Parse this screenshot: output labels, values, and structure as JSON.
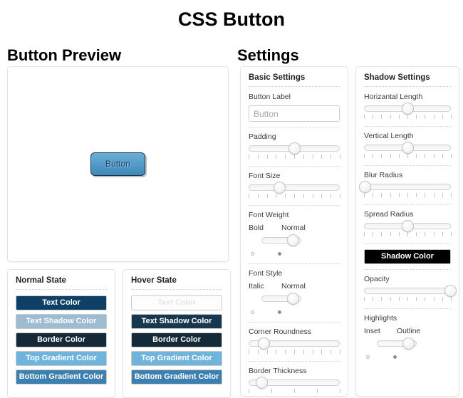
{
  "page": {
    "title": "CSS Button"
  },
  "preview": {
    "heading": "Button Preview",
    "button_label": "Button"
  },
  "settings": {
    "heading": "Settings"
  },
  "normal_state": {
    "title": "Normal State",
    "swatches": [
      {
        "label": "Text Color",
        "bg": "#0e3f66",
        "fg": "#ffffff"
      },
      {
        "label": "Text Shadow Color",
        "bg": "#9dbcd2",
        "fg": "#ffffff"
      },
      {
        "label": "Border Color",
        "bg": "#152a38",
        "fg": "#ffffff"
      },
      {
        "label": "Top Gradient Color",
        "bg": "#6fb4dd",
        "fg": "#ffffff"
      },
      {
        "label": "Bottom Gradient Color",
        "bg": "#3d80b0",
        "fg": "#ffffff"
      }
    ]
  },
  "hover_state": {
    "title": "Hover State",
    "swatches": [
      {
        "label": "Text Color",
        "bg": "#fdfdfd",
        "fg": "#dfe7ec"
      },
      {
        "label": "Text Shadow Color",
        "bg": "#16374e",
        "fg": "#ffffff"
      },
      {
        "label": "Border Color",
        "bg": "#152a38",
        "fg": "#ffffff"
      },
      {
        "label": "Top Gradient Color",
        "bg": "#6fb4dd",
        "fg": "#ffffff"
      },
      {
        "label": "Bottom Gradient Color",
        "bg": "#3d80b0",
        "fg": "#ffffff"
      }
    ]
  },
  "basic_settings": {
    "title": "Basic Settings",
    "button_label_field": {
      "label": "Button Label",
      "value": "",
      "placeholder": "Button"
    },
    "sliders": [
      {
        "label": "Padding",
        "percent": 50,
        "ticks": 11
      },
      {
        "label": "Font Size",
        "percent": 34,
        "ticks": 11
      },
      {
        "label": "Corner Roundness",
        "percent": 16,
        "ticks": 11
      },
      {
        "label": "Border Thickness",
        "percent": 14,
        "ticks": 5
      }
    ],
    "toggles": [
      {
        "label": "Font Weight",
        "option_left": "Bold",
        "option_right": "Normal",
        "selected": "Normal"
      },
      {
        "label": "Font Style",
        "option_left": "Italic",
        "option_right": "Normal",
        "selected": "Normal"
      }
    ]
  },
  "shadow_settings": {
    "title": "Shadow Settings",
    "sliders": [
      {
        "label": "Horizantal Length",
        "percent": 50,
        "ticks": 11
      },
      {
        "label": "Vertical Length",
        "percent": 50,
        "ticks": 11
      },
      {
        "label": "Blur Radius",
        "percent": 0,
        "ticks": 11
      },
      {
        "label": "Spread Radius",
        "percent": 50,
        "ticks": 11
      },
      {
        "label": "Opacity",
        "percent": 100,
        "ticks": 11
      }
    ],
    "shadow_color_button": {
      "label": "Shadow Color",
      "bg": "#000000",
      "fg": "#ffffff"
    },
    "highlights_toggle": {
      "label": "Highlights",
      "option_left": "Inset",
      "option_right": "Outline",
      "selected": "Outline"
    }
  }
}
